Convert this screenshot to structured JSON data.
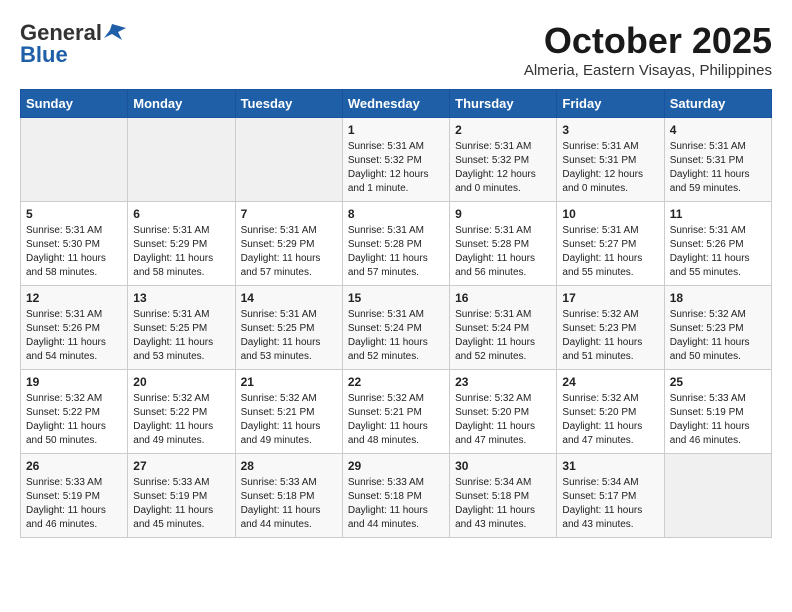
{
  "header": {
    "logo_general": "General",
    "logo_blue": "Blue",
    "month": "October 2025",
    "location": "Almeria, Eastern Visayas, Philippines"
  },
  "weekdays": [
    "Sunday",
    "Monday",
    "Tuesday",
    "Wednesday",
    "Thursday",
    "Friday",
    "Saturday"
  ],
  "weeks": [
    [
      {
        "day": "",
        "sunrise": "",
        "sunset": "",
        "daylight": ""
      },
      {
        "day": "",
        "sunrise": "",
        "sunset": "",
        "daylight": ""
      },
      {
        "day": "",
        "sunrise": "",
        "sunset": "",
        "daylight": ""
      },
      {
        "day": "1",
        "sunrise": "Sunrise: 5:31 AM",
        "sunset": "Sunset: 5:32 PM",
        "daylight": "Daylight: 12 hours and 1 minute."
      },
      {
        "day": "2",
        "sunrise": "Sunrise: 5:31 AM",
        "sunset": "Sunset: 5:32 PM",
        "daylight": "Daylight: 12 hours and 0 minutes."
      },
      {
        "day": "3",
        "sunrise": "Sunrise: 5:31 AM",
        "sunset": "Sunset: 5:31 PM",
        "daylight": "Daylight: 12 hours and 0 minutes."
      },
      {
        "day": "4",
        "sunrise": "Sunrise: 5:31 AM",
        "sunset": "Sunset: 5:31 PM",
        "daylight": "Daylight: 11 hours and 59 minutes."
      }
    ],
    [
      {
        "day": "5",
        "sunrise": "Sunrise: 5:31 AM",
        "sunset": "Sunset: 5:30 PM",
        "daylight": "Daylight: 11 hours and 58 minutes."
      },
      {
        "day": "6",
        "sunrise": "Sunrise: 5:31 AM",
        "sunset": "Sunset: 5:29 PM",
        "daylight": "Daylight: 11 hours and 58 minutes."
      },
      {
        "day": "7",
        "sunrise": "Sunrise: 5:31 AM",
        "sunset": "Sunset: 5:29 PM",
        "daylight": "Daylight: 11 hours and 57 minutes."
      },
      {
        "day": "8",
        "sunrise": "Sunrise: 5:31 AM",
        "sunset": "Sunset: 5:28 PM",
        "daylight": "Daylight: 11 hours and 57 minutes."
      },
      {
        "day": "9",
        "sunrise": "Sunrise: 5:31 AM",
        "sunset": "Sunset: 5:28 PM",
        "daylight": "Daylight: 11 hours and 56 minutes."
      },
      {
        "day": "10",
        "sunrise": "Sunrise: 5:31 AM",
        "sunset": "Sunset: 5:27 PM",
        "daylight": "Daylight: 11 hours and 55 minutes."
      },
      {
        "day": "11",
        "sunrise": "Sunrise: 5:31 AM",
        "sunset": "Sunset: 5:26 PM",
        "daylight": "Daylight: 11 hours and 55 minutes."
      }
    ],
    [
      {
        "day": "12",
        "sunrise": "Sunrise: 5:31 AM",
        "sunset": "Sunset: 5:26 PM",
        "daylight": "Daylight: 11 hours and 54 minutes."
      },
      {
        "day": "13",
        "sunrise": "Sunrise: 5:31 AM",
        "sunset": "Sunset: 5:25 PM",
        "daylight": "Daylight: 11 hours and 53 minutes."
      },
      {
        "day": "14",
        "sunrise": "Sunrise: 5:31 AM",
        "sunset": "Sunset: 5:25 PM",
        "daylight": "Daylight: 11 hours and 53 minutes."
      },
      {
        "day": "15",
        "sunrise": "Sunrise: 5:31 AM",
        "sunset": "Sunset: 5:24 PM",
        "daylight": "Daylight: 11 hours and 52 minutes."
      },
      {
        "day": "16",
        "sunrise": "Sunrise: 5:31 AM",
        "sunset": "Sunset: 5:24 PM",
        "daylight": "Daylight: 11 hours and 52 minutes."
      },
      {
        "day": "17",
        "sunrise": "Sunrise: 5:32 AM",
        "sunset": "Sunset: 5:23 PM",
        "daylight": "Daylight: 11 hours and 51 minutes."
      },
      {
        "day": "18",
        "sunrise": "Sunrise: 5:32 AM",
        "sunset": "Sunset: 5:23 PM",
        "daylight": "Daylight: 11 hours and 50 minutes."
      }
    ],
    [
      {
        "day": "19",
        "sunrise": "Sunrise: 5:32 AM",
        "sunset": "Sunset: 5:22 PM",
        "daylight": "Daylight: 11 hours and 50 minutes."
      },
      {
        "day": "20",
        "sunrise": "Sunrise: 5:32 AM",
        "sunset": "Sunset: 5:22 PM",
        "daylight": "Daylight: 11 hours and 49 minutes."
      },
      {
        "day": "21",
        "sunrise": "Sunrise: 5:32 AM",
        "sunset": "Sunset: 5:21 PM",
        "daylight": "Daylight: 11 hours and 49 minutes."
      },
      {
        "day": "22",
        "sunrise": "Sunrise: 5:32 AM",
        "sunset": "Sunset: 5:21 PM",
        "daylight": "Daylight: 11 hours and 48 minutes."
      },
      {
        "day": "23",
        "sunrise": "Sunrise: 5:32 AM",
        "sunset": "Sunset: 5:20 PM",
        "daylight": "Daylight: 11 hours and 47 minutes."
      },
      {
        "day": "24",
        "sunrise": "Sunrise: 5:32 AM",
        "sunset": "Sunset: 5:20 PM",
        "daylight": "Daylight: 11 hours and 47 minutes."
      },
      {
        "day": "25",
        "sunrise": "Sunrise: 5:33 AM",
        "sunset": "Sunset: 5:19 PM",
        "daylight": "Daylight: 11 hours and 46 minutes."
      }
    ],
    [
      {
        "day": "26",
        "sunrise": "Sunrise: 5:33 AM",
        "sunset": "Sunset: 5:19 PM",
        "daylight": "Daylight: 11 hours and 46 minutes."
      },
      {
        "day": "27",
        "sunrise": "Sunrise: 5:33 AM",
        "sunset": "Sunset: 5:19 PM",
        "daylight": "Daylight: 11 hours and 45 minutes."
      },
      {
        "day": "28",
        "sunrise": "Sunrise: 5:33 AM",
        "sunset": "Sunset: 5:18 PM",
        "daylight": "Daylight: 11 hours and 44 minutes."
      },
      {
        "day": "29",
        "sunrise": "Sunrise: 5:33 AM",
        "sunset": "Sunset: 5:18 PM",
        "daylight": "Daylight: 11 hours and 44 minutes."
      },
      {
        "day": "30",
        "sunrise": "Sunrise: 5:34 AM",
        "sunset": "Sunset: 5:18 PM",
        "daylight": "Daylight: 11 hours and 43 minutes."
      },
      {
        "day": "31",
        "sunrise": "Sunrise: 5:34 AM",
        "sunset": "Sunset: 5:17 PM",
        "daylight": "Daylight: 11 hours and 43 minutes."
      },
      {
        "day": "",
        "sunrise": "",
        "sunset": "",
        "daylight": ""
      }
    ]
  ]
}
